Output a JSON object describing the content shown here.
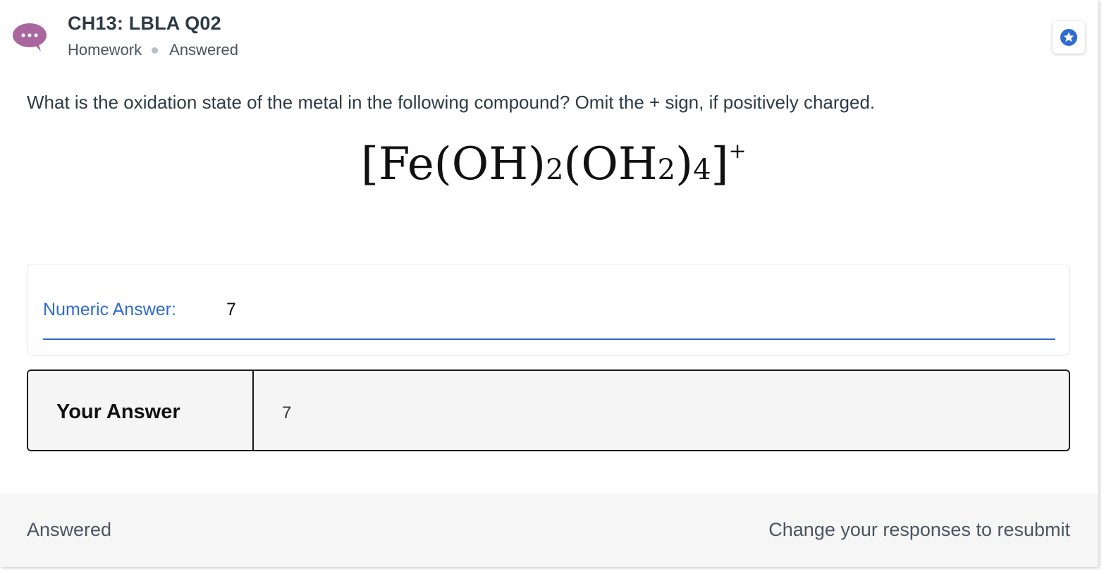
{
  "header": {
    "title": "CH13: LBLA Q02",
    "category": "Homework",
    "status": "Answered",
    "avatar_icon": "chat-bubble-icon",
    "avatar_color": "#a9669f",
    "star_icon": "star-badge-icon",
    "star_color": "#2f6bd0"
  },
  "question": {
    "text": "What is the oxidation state of the metal in the following compound? Omit the + sign, if positively charged.",
    "formula": {
      "open": "[Fe(OH)",
      "sub1": "2",
      "mid": "(OH",
      "sub2": "2",
      "close_paren": ")",
      "sub3": "4",
      "close_bracket": "]",
      "charge": "+"
    }
  },
  "numeric_answer": {
    "label": "Numeric Answer:",
    "value": "7"
  },
  "your_answer": {
    "label": "Your Answer",
    "value": "7"
  },
  "footer": {
    "status": "Answered",
    "action": "Change your responses to resubmit"
  },
  "colors": {
    "accent": "#2f6bd0",
    "text": "#2d3b45",
    "footer_bg": "#f6f6f6"
  }
}
